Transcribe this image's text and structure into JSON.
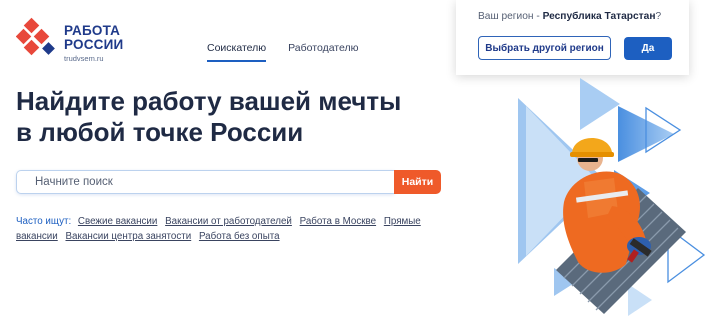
{
  "logo": {
    "line1": "РАБОТА",
    "line2": "РОССИИ",
    "url": "trudvsem.ru"
  },
  "nav": {
    "tabs": [
      {
        "label": "Соискателю",
        "active": true
      },
      {
        "label": "Работодателю",
        "active": false
      }
    ]
  },
  "headline": {
    "line1": "Найдите работу вашей мечты",
    "line2": "в любой точке России"
  },
  "search": {
    "placeholder": "Начните поиск",
    "button": "Найти"
  },
  "popular": {
    "label": "Часто ищут:",
    "links": [
      "Свежие вакансии",
      "Вакансии от работодателей",
      "Работа в Москве",
      "Прямые вакансии",
      "Вакансии центра занятости",
      "Работа без опыта"
    ]
  },
  "region": {
    "prefix": "Ваш регион - ",
    "name": "Республика Татарстан",
    "suffix": "?",
    "change_button": "Выбрать другой регион",
    "confirm_button": "Да"
  },
  "colors": {
    "accent": "#1d5fc1",
    "brand_red": "#e8483b",
    "search_button": "#ef5a2a",
    "text_dark": "#1f2a44"
  },
  "icons": [
    "logo-mark-icon",
    "hero-worker-illustration"
  ]
}
